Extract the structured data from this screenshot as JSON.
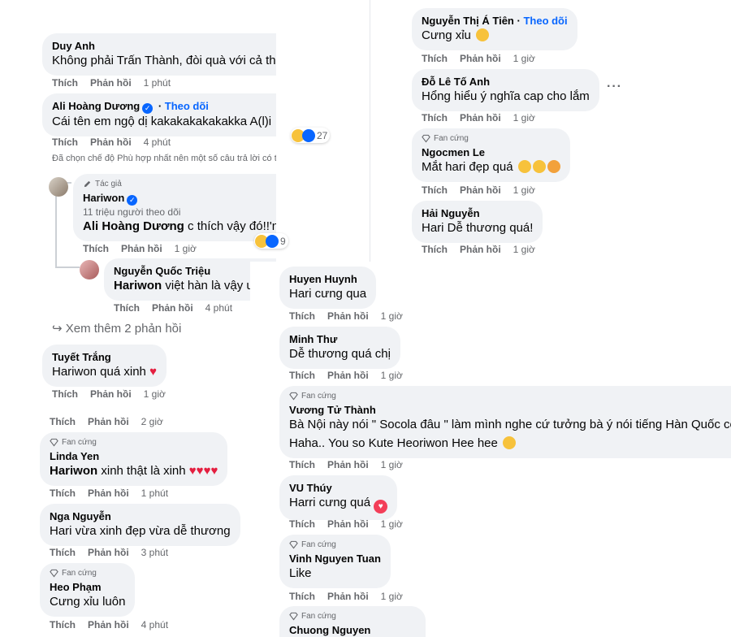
{
  "left": {
    "duy_anh": {
      "name": "Duy Anh",
      "text": "Không phải Trấn Thành, đòi quà với cả thế giới à bà",
      "like": "Thích",
      "reply": "Phản hồi",
      "time": "1 phút"
    },
    "ali": {
      "name": "Ali Hoàng Dương",
      "follow": "Theo dõi",
      "text": "Cái tên em ngộ dị kakakakakakakka A(l)i",
      "reactions": "27",
      "like": "Thích",
      "reply": "Phản hồi",
      "time": "4 phút"
    },
    "filter_note": "Đã chọn chế độ Phù hợp nhất nên một số câu trả lời có thể bị lọc ra.",
    "hariwon": {
      "badge": "Tác giả",
      "name": "Hariwon",
      "followers": "11 triệu người theo dõi",
      "mention": "Ali Hoàng Dương",
      "text": "c thích vậy đó!!'nnn",
      "reactions": "9",
      "like": "Thích",
      "reply": "Phản hồi",
      "time": "1 giờ"
    },
    "trieu": {
      "name": "Nguyễn Quốc Triệu",
      "mention": "Hariwon",
      "text": "việt hàn là vậy ư",
      "like": "Thích",
      "reply": "Phản hồi",
      "time": "4 phút"
    },
    "see_more": "Xem thêm 2 phản hồi",
    "tuyet": {
      "name": "Tuyết Trắng",
      "text": "Hariwon quá xinh",
      "like": "Thích",
      "reply": "Phản hồi",
      "time": "1 giờ"
    },
    "partial": {
      "like": "Thích",
      "reply": "Phản hồi",
      "time": "2 giờ"
    },
    "linda": {
      "fan": "Fan cứng",
      "name": "Linda Yen",
      "mention": "Hariwon",
      "text": "xinh thật là xinh",
      "like": "Thích",
      "reply": "Phản hồi",
      "time": "1 phút"
    },
    "nga": {
      "name": "Nga Nguyễn",
      "text": "Hari vừa xinh đẹp vừa dễ thương",
      "like": "Thích",
      "reply": "Phản hồi",
      "time": "3 phút"
    },
    "heo": {
      "fan": "Fan cứng",
      "name": "Heo Phạm",
      "text": "Cưng xỉu luôn",
      "like": "Thích",
      "reply": "Phản hồi",
      "time": "4 phút"
    }
  },
  "right": {
    "atien": {
      "name": "Nguyễn Thị Á Tiên",
      "follow": "Theo dõi",
      "text": "Cưng xỉu",
      "like": "Thích",
      "reply": "Phản hồi",
      "time": "1 giờ"
    },
    "toanh": {
      "name": "Đỗ Lê Tố Anh",
      "text": "Hổng hiểu ý nghĩa cap cho lắm",
      "like": "Thích",
      "reply": "Phản hồi",
      "time": "1 giờ"
    },
    "ngocmen": {
      "fan": "Fan cứng",
      "name": "Ngocmen Le",
      "text": "Mắt hari đẹp quá",
      "like": "Thích",
      "reply": "Phản hồi",
      "time": "1 giờ"
    },
    "hai": {
      "name": "Hải Nguyễn",
      "text": "Hari Dễ thương quá!",
      "like": "Thích",
      "reply": "Phản hồi",
      "time": "1 giờ"
    }
  },
  "middle": {
    "huyen": {
      "name": "Huyen Huynh",
      "text": "Hari cưng qua",
      "like": "Thích",
      "reply": "Phản hồi",
      "time": "1 giờ"
    },
    "minh": {
      "name": "Minh Thư",
      "text": "Dễ thương quá chị",
      "like": "Thích",
      "reply": "Phản hồi",
      "time": "1 giờ"
    },
    "vuong": {
      "fan": "Fan cứng",
      "name": "Vương Tử Thành",
      "text1": "Bà Nội này nói \" Socola đâu \" làm mình nghe cứ tưởng bà ý nói tiếng Hàn Quốc co",
      "text2": "Haha.. You so Kute Heoriwon Hee hee",
      "like": "Thích",
      "reply": "Phản hồi",
      "time": "1 giờ"
    },
    "vuthuy": {
      "name": "VU Thúy",
      "text": "Harri cưng quá",
      "like": "Thích",
      "reply": "Phản hồi",
      "time": "1 giờ"
    },
    "vinh": {
      "fan": "Fan cứng",
      "name": "Vinh Nguyen Tuan",
      "text": "Like",
      "like": "Thích",
      "reply": "Phản hồi",
      "time": "1 giờ"
    },
    "chuong": {
      "fan": "Fan cứng",
      "name": "Chuong Nguyen"
    }
  },
  "colors": {
    "bubble": "#f0f2f5",
    "link": "#0866ff",
    "meta": "#65676b",
    "heart": "#e41e3f"
  }
}
